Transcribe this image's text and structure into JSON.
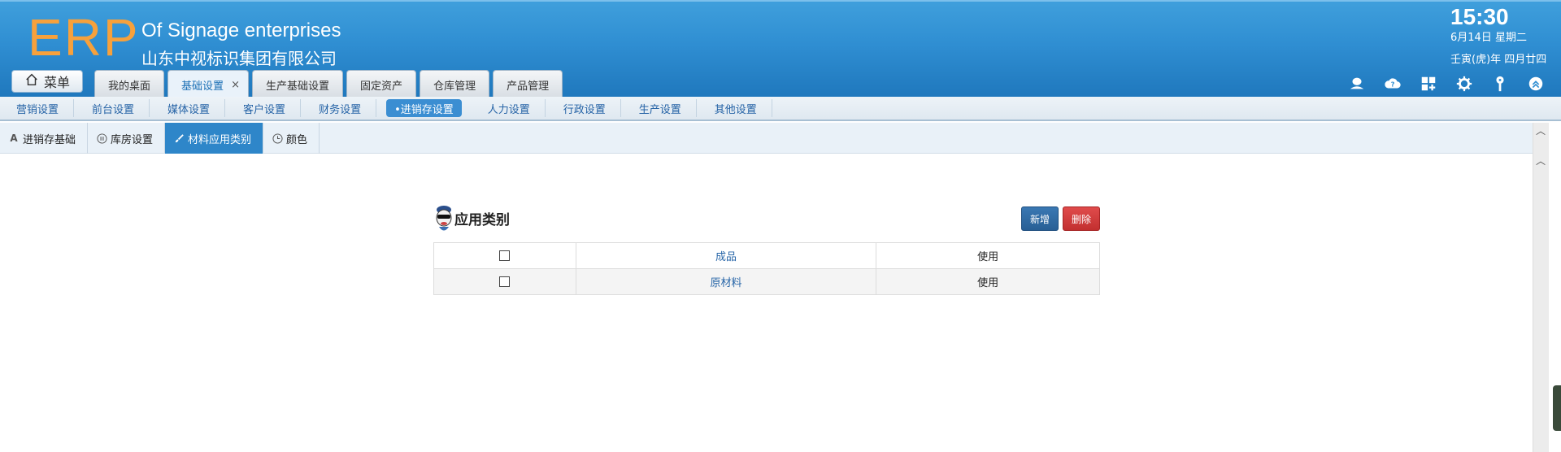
{
  "header": {
    "logo": "ERP",
    "company_en": "Of Signage enterprises",
    "company_cn": "山东中视标识集团有限公司",
    "time": "15:30",
    "date": "6月14日 星期二",
    "lunar": "壬寅(虎)年 四月廿四",
    "menu_label": "菜单",
    "tabs": [
      {
        "label": "我的桌面"
      },
      {
        "label": "基础设置",
        "active": true,
        "close": "×"
      },
      {
        "label": "生产基础设置"
      },
      {
        "label": "固定资产"
      },
      {
        "label": "仓库管理"
      },
      {
        "label": "产品管理"
      }
    ],
    "icons": [
      "user-icon",
      "help-cloud-icon",
      "apps-grid-icon",
      "settings-gear-icon",
      "key-icon",
      "collapse-up-icon"
    ]
  },
  "subnav": {
    "items": [
      {
        "label": "营销设置"
      },
      {
        "label": "前台设置"
      },
      {
        "label": "媒体设置"
      },
      {
        "label": "客户设置"
      },
      {
        "label": "财务设置"
      },
      {
        "label": "•进销存设置",
        "active": true
      },
      {
        "label": "人力设置"
      },
      {
        "label": "行政设置"
      },
      {
        "label": "生产设置"
      },
      {
        "label": "其他设置"
      }
    ]
  },
  "tertiary": {
    "items": [
      {
        "label": "进销存基础",
        "icon": "A"
      },
      {
        "label": "库房设置",
        "icon": "pause-circle-icon"
      },
      {
        "label": "材料应用类别",
        "icon": "brush-icon",
        "active": true
      },
      {
        "label": "颜色",
        "icon": "clock-icon"
      }
    ]
  },
  "panel": {
    "title": "应用类别",
    "add_label": "新增",
    "delete_label": "删除",
    "rows": [
      {
        "name": "成品",
        "status": "使用"
      },
      {
        "name": "原材料",
        "status": "使用"
      }
    ]
  },
  "colors": {
    "header_blue": "#2f8ed2",
    "logo_orange": "#f7a13c",
    "active_tab_blue": "#2e86c9",
    "add_button": "#285f95",
    "delete_button": "#c23030",
    "link_blue": "#2866a8"
  }
}
